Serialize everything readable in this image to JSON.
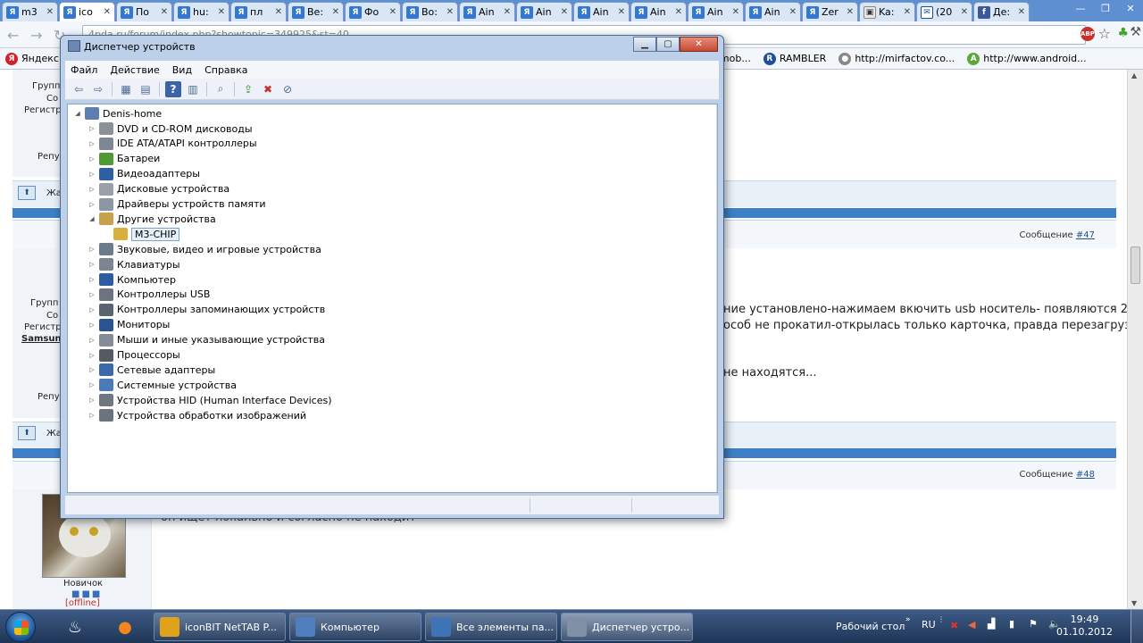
{
  "browser": {
    "tabs": [
      {
        "icon": "Я",
        "label": "m3",
        "kind": "yandex"
      },
      {
        "icon": "Я",
        "label": "ico",
        "kind": "yandex",
        "active": true
      },
      {
        "icon": "Я",
        "label": "По",
        "kind": "yandex"
      },
      {
        "icon": "Я",
        "label": "hu:",
        "kind": "yandex"
      },
      {
        "icon": "Я",
        "label": "пл",
        "kind": "yandex"
      },
      {
        "icon": "Я",
        "label": "Be:",
        "kind": "yandex"
      },
      {
        "icon": "Я",
        "label": "Фо",
        "kind": "yandex"
      },
      {
        "icon": "Я",
        "label": "Bo:",
        "kind": "yandex"
      },
      {
        "icon": "Я",
        "label": "Ain",
        "kind": "yandex"
      },
      {
        "icon": "Я",
        "label": "Ain",
        "kind": "yandex"
      },
      {
        "icon": "Я",
        "label": "Ain",
        "kind": "yandex"
      },
      {
        "icon": "Я",
        "label": "Ain",
        "kind": "yandex"
      },
      {
        "icon": "Я",
        "label": "Ain",
        "kind": "yandex"
      },
      {
        "icon": "Я",
        "label": "Ain",
        "kind": "yandex"
      },
      {
        "icon": "Я",
        "label": "Zer",
        "kind": "yandex"
      },
      {
        "icon": "▣",
        "label": "Ka:",
        "kind": "doc"
      },
      {
        "icon": "✉",
        "label": "(20",
        "kind": "mail"
      },
      {
        "icon": "f",
        "label": "Де:",
        "kind": "fb"
      }
    ],
    "url": "4pda.ru/forum/index.php?showtopic=349925&st=40",
    "bookmarks": [
      {
        "icon": "Я",
        "label": "Яндекс",
        "color": "#d4202a"
      },
      {
        "icon": "▤",
        "label": "promob...",
        "color": "#7f8a99"
      },
      {
        "icon": "R",
        "label": "RAMBLER",
        "color": "#1f4f95"
      },
      {
        "icon": "●",
        "label": "http://mirfactov.co...",
        "color": "#888888"
      },
      {
        "icon": "A",
        "label": "http://www.android...",
        "color": "#5ea83a"
      }
    ]
  },
  "forum": {
    "side_labels": [
      "Групп",
      "Со",
      "Регистр",
      "Репу",
      "Групп",
      "Со",
      "Регистр",
      "Samsun",
      "Репу",
      "Новичок"
    ],
    "jump_label": "Жа",
    "msg_prefix": "Сообщение",
    "msg47": "#47",
    "msg48": "#48",
    "text1": "ние установлено-нажимаем вкючить usb носитель- появляются 2",
    "text2": "особ не прокатил-открылась только карточка, правда перезагрузка и",
    "text3": "не находятся...",
    "text4": "он ищет локально и согласно не находит",
    "offline": "[offline]",
    "rank": "Новичок"
  },
  "devmgr": {
    "title": "Диспетчер устройств",
    "menu": [
      "Файл",
      "Действие",
      "Вид",
      "Справка"
    ],
    "root": "Denis-home",
    "items": [
      {
        "label": "DVD и CD-ROM дисководы",
        "color": "#8b9099"
      },
      {
        "label": "IDE ATA/ATAPI контроллеры",
        "color": "#7e8795"
      },
      {
        "label": "Батареи",
        "color": "#4f9a35"
      },
      {
        "label": "Видеоадаптеры",
        "color": "#2f5fa3"
      },
      {
        "label": "Дисковые устройства",
        "color": "#9aa0a8"
      },
      {
        "label": "Драйверы устройств памяти",
        "color": "#8d96a5"
      },
      {
        "label": "Другие устройства",
        "color": "#c7a24a",
        "expanded": true
      },
      {
        "label": "M3-CHIP",
        "color": "#d9b03a",
        "child": true,
        "selected": true
      },
      {
        "label": "Звуковые, видео и игровые устройства",
        "color": "#6b7a8c"
      },
      {
        "label": "Клавиатуры",
        "color": "#7d8591"
      },
      {
        "label": "Компьютер",
        "color": "#2d5ca0"
      },
      {
        "label": "Контроллеры USB",
        "color": "#6c7480"
      },
      {
        "label": "Контроллеры запоминающих устройств",
        "color": "#5a6470"
      },
      {
        "label": "Мониторы",
        "color": "#2a5394"
      },
      {
        "label": "Мыши и иные указывающие устройства",
        "color": "#858c96"
      },
      {
        "label": "Процессоры",
        "color": "#555b63"
      },
      {
        "label": "Сетевые адаптеры",
        "color": "#3c6aa8"
      },
      {
        "label": "Системные устройства",
        "color": "#4a7ab8"
      },
      {
        "label": "Устройства HID (Human Interface Devices)",
        "color": "#6f7782"
      },
      {
        "label": "Устройства обработки изображений",
        "color": "#6b737d"
      }
    ]
  },
  "taskbar": {
    "tasks": [
      {
        "label": "iconBIT NetTAB P...",
        "color": "#e0a21b"
      },
      {
        "label": "Компьютер",
        "color": "#4f7fbf"
      },
      {
        "label": "Все элементы па...",
        "color": "#3f74b8"
      },
      {
        "label": "Диспетчер устро...",
        "color": "#8090a6",
        "active": true
      }
    ],
    "desktop_label": "Рабочий стол",
    "lang": "RU",
    "time": "19:49",
    "date": "01.10.2012"
  }
}
